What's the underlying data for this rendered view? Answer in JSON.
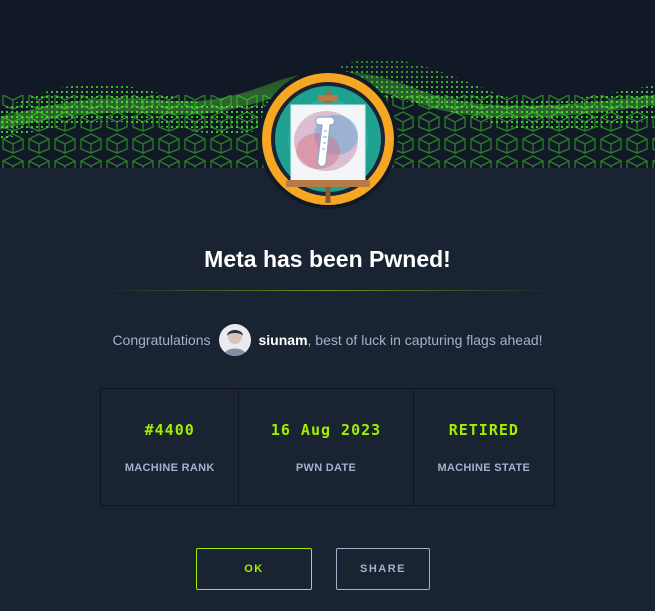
{
  "header": {
    "title": "Meta has been Pwned!"
  },
  "congrats": {
    "prefix": "Congratulations",
    "username": "siunam",
    "suffix": ", best of luck in capturing flags ahead!"
  },
  "stats": [
    {
      "value": "#4400",
      "label": "MACHINE RANK"
    },
    {
      "value": "16 Aug 2023",
      "label": "PWN DATE"
    },
    {
      "value": "RETIRED",
      "label": "MACHINE STATE"
    }
  ],
  "buttons": {
    "ok": "OK",
    "share": "SHARE"
  },
  "colors": {
    "accent": "#9fef00",
    "background": "#1a2332",
    "muted_text": "#a4b1cd",
    "badge_ring": "#f5a623",
    "badge_inner": "#1fa191"
  },
  "icons": {
    "banner": "green-cube-wave-banner",
    "badge": "easel-scroll-machine-icon",
    "avatar": "user-avatar"
  }
}
